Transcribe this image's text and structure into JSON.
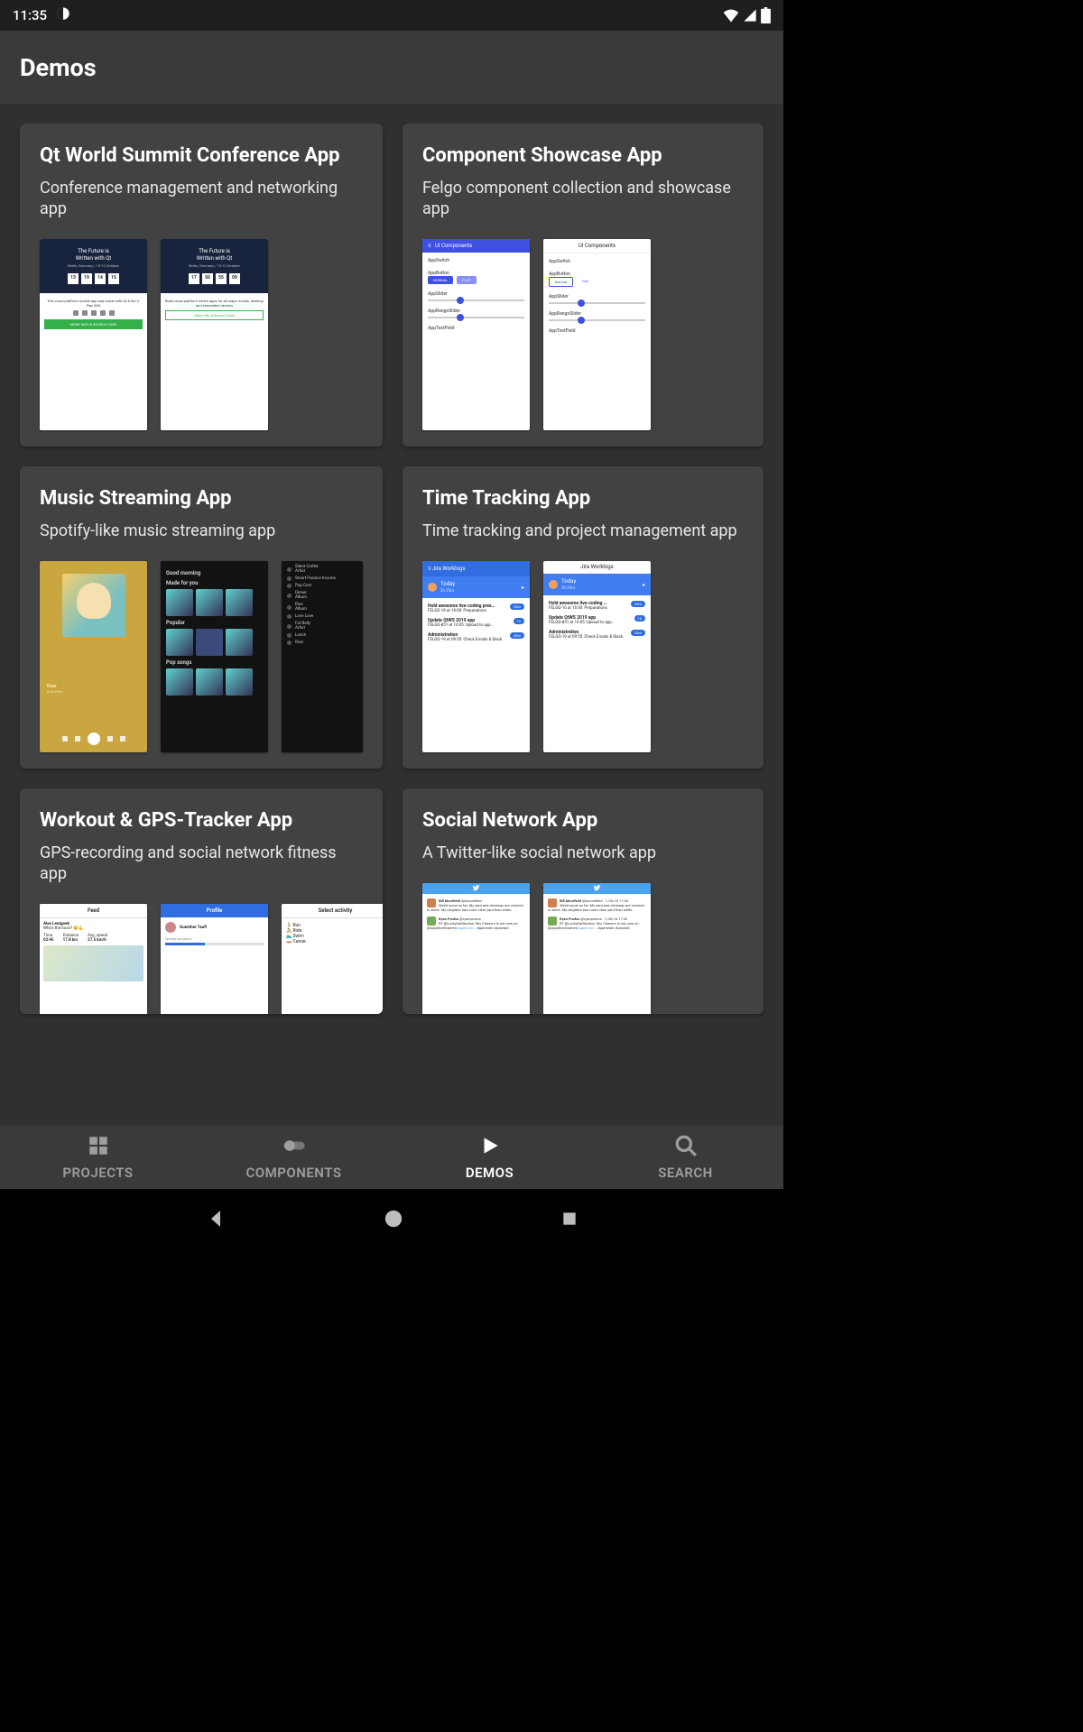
{
  "status": {
    "time": "11:35"
  },
  "appbar": {
    "title": "Demos"
  },
  "cards": [
    {
      "title": "Qt World Summit Conference App",
      "desc": "Conference management and networking app"
    },
    {
      "title": "Component Showcase App",
      "desc": "Felgo component collection and showcase app"
    },
    {
      "title": "Music Streaming App",
      "desc": "Spotify-like music streaming app"
    },
    {
      "title": "Time Tracking App",
      "desc": "Time tracking and project management app"
    },
    {
      "title": "Workout & GPS-Tracker App",
      "desc": "GPS-recording and social network fitness app"
    },
    {
      "title": "Social Network App",
      "desc": "A Twitter-like social network app"
    }
  ],
  "nav": {
    "projects": "PROJECTS",
    "components": "COMPONENTS",
    "demos": "DEMOS",
    "search": "SEARCH"
  }
}
